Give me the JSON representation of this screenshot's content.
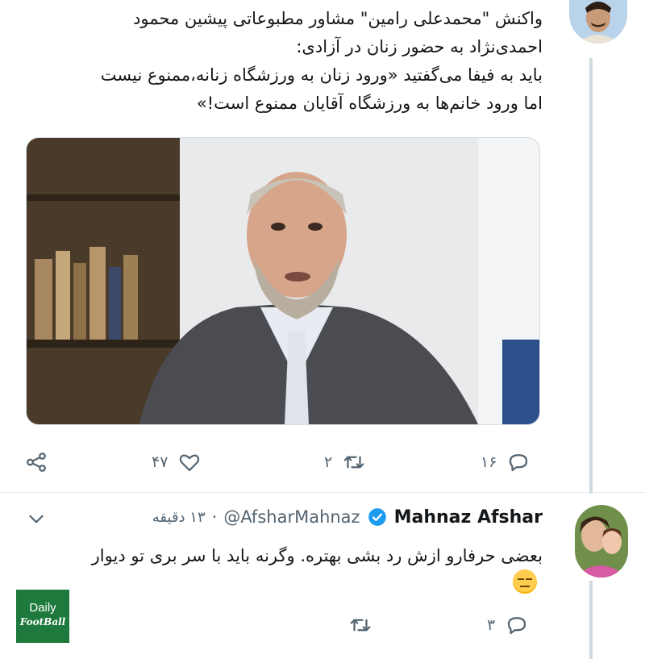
{
  "tweet1": {
    "text_lines": [
      "واکنش \"محمدعلی رامین\" مشاور مطبوعاتی پیشین محمود",
      "احمدی‌نژاد به حضور زنان در آزادی:",
      "باید به فیفا می‌گفتید «ورود زنان به ورزشگاه زنانه،ممنوع نیست",
      "اما ورود خانم‌ها به ورزشگاه آقایان ممنوع است!»"
    ],
    "actions": {
      "reply_count": "۱۶",
      "retweet_count": "۲",
      "like_count": "۴۷"
    },
    "icons": [
      "share-icon",
      "heart-icon",
      "retweet-icon",
      "reply-icon"
    ]
  },
  "tweet2": {
    "display_name": "Mahnaz Afshar",
    "handle": "@AfsharMahnaz",
    "time": "۱۳ دقیقه",
    "separator": "·",
    "text_lines": [
      "بعضی حرفارو ازش رد بشی بهتره. وگرنه باید با سر بری تو دیوار"
    ],
    "emoji": "expressionless-face",
    "actions": {
      "reply_count": "۳"
    },
    "icons": [
      "verified-badge-icon",
      "chevron-down-icon",
      "retweet-icon",
      "reply-icon"
    ]
  },
  "watermark": {
    "line1": "Daily",
    "line2": "FootBall",
    "color": "#1e7a3c"
  },
  "colors": {
    "verified": "#1d9bf0",
    "muted": "#536471",
    "thread_line": "#cfd9de"
  }
}
